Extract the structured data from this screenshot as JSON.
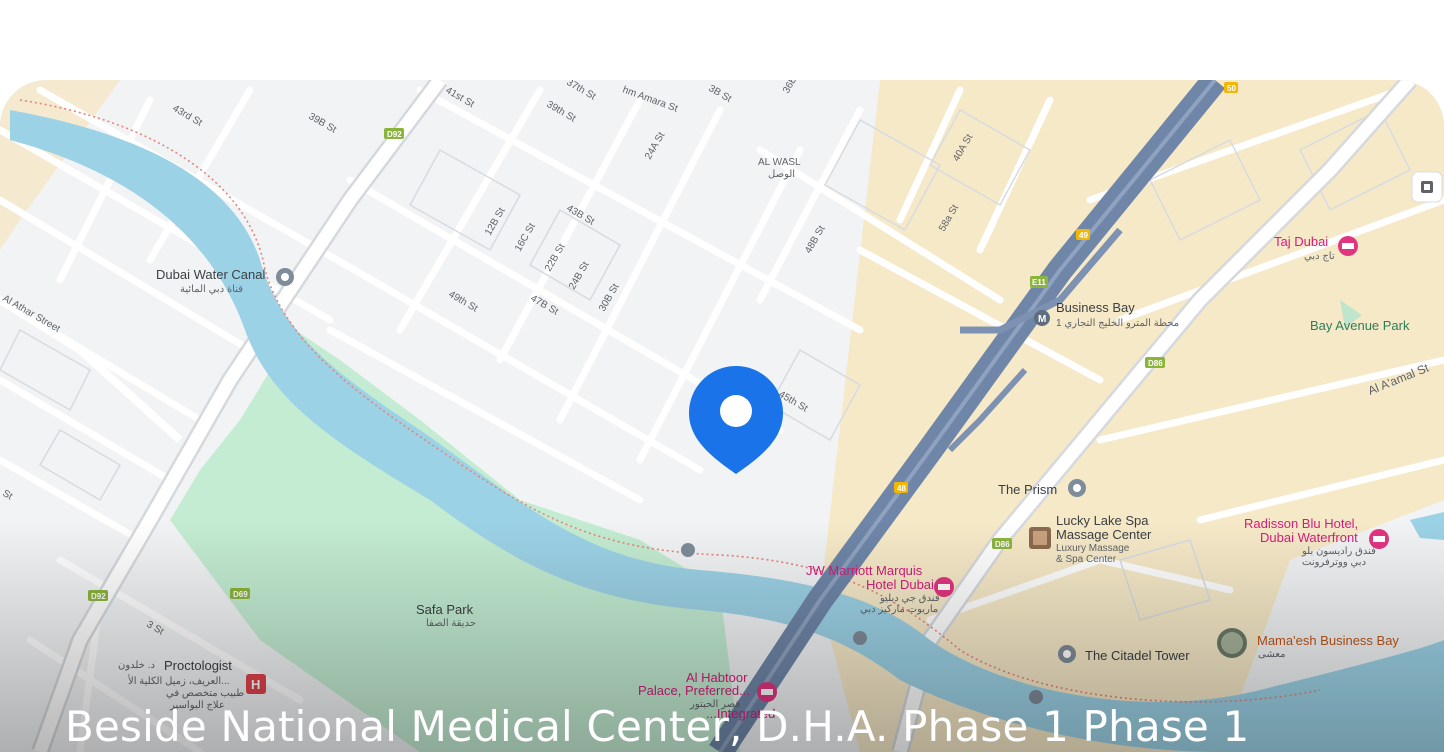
{
  "location": {
    "address": "Beside National Medical Center, D.H.A. Phase 1 Phase 1"
  },
  "map": {
    "labels": {
      "dubai_water_canal": "Dubai Water Canal",
      "dubai_water_canal_ar": "قناة دبي المائية",
      "al_wasl": "AL WASL",
      "al_wasl_ar": "الوصل",
      "business_bay": "Business Bay",
      "business_bay_ar": "محطة المترو الخليج التجاري 1",
      "taj_dubai": "Taj Dubai",
      "taj_dubai_ar": "تاج دبي",
      "bay_avenue_park": "Bay Avenue Park",
      "al_aamal_st": "Al A'amal St",
      "al_athar_street": "Al Athar Street",
      "the_prism": "The Prism",
      "lucky_lake_1": "Lucky Lake Spa",
      "lucky_lake_2": "Massage Center",
      "lucky_lake_sub1": "Luxury Massage",
      "lucky_lake_sub2": "& Spa Center",
      "radisson_1": "Radisson Blu Hotel,",
      "radisson_2": "Dubai Waterfront",
      "radisson_ar1": "فندق راديسون بلو",
      "radisson_ar2": "دبي ووترفرونت",
      "jw_1": "JW Marriott Marquis",
      "jw_2": "Hotel Dubai",
      "jw_ar1": "فندق جي دبليو",
      "jw_ar2": "ماريوت ماركيز دبي",
      "safa_park": "Safa Park",
      "safa_park_ar": "حديقة الصفا",
      "proctologist": "Proctologist",
      "proctologist_ar1": "د. خلدون",
      "proctologist_ar2": "العريف، زميل الكلية الأ...",
      "proctologist_ar3": "طبيب متخصص في",
      "proctologist_ar4": "علاج البواسير",
      "citadel_tower": "The Citadel Tower",
      "mamaesh": "Mama'esh Business Bay",
      "mamaesh_ar": "معشى",
      "habtoor_1": "Al Habtoor",
      "habtoor_2": "Palace, Preferred...",
      "habtoor_ar": "قصر الحبتور",
      "habtoor_3": "...Integrated",
      "street": "St",
      "st_43rd": "43rd St",
      "st_39b": "39B St",
      "st_41st": "41st St",
      "st_37th": "37th St",
      "st_39th": "39th St",
      "st_amara": "hm Amara St",
      "st_24a": "24A St",
      "st_3b": "3B St",
      "st_36b": "36B",
      "st_12b": "12B St",
      "st_16c": "16C St",
      "st_43b": "43B St",
      "st_22b": "22B St",
      "st_24b": "24B St",
      "st_49th": "49th St",
      "st_47b": "47B St",
      "st_30b": "30B St",
      "st_48b": "48B St",
      "st_40a": "40A St",
      "st_58a": "58a St",
      "st_45th": "45th St",
      "st_3": "3 St"
    },
    "shields": {
      "d92": "D92",
      "d69": "D69",
      "d92b": "D92",
      "d86a": "D86",
      "d86b": "D86",
      "e11": "E11",
      "r49": "49",
      "r48": "48",
      "r50": "50"
    },
    "icons": {
      "location_pin": "map-marker-icon",
      "metro": "metro-icon",
      "hotel": "hotel-icon",
      "hospital": "hospital-icon",
      "landmark": "landmark-icon",
      "restaurant": "restaurant-photo-icon",
      "spa": "spa-photo-icon",
      "layers": "layers-icon"
    },
    "colors": {
      "pin": "#1a73e8",
      "water": "#9cd2e6",
      "park": "#c3ecd2",
      "land": "#f1f3f4",
      "sand": "#f6e9c8",
      "highway": "#6f86a8",
      "minor_road": "#ffffff",
      "hotel_pink": "#e2357f",
      "road_shield": "#8bb43c",
      "highway_shield": "#f2b705"
    }
  }
}
